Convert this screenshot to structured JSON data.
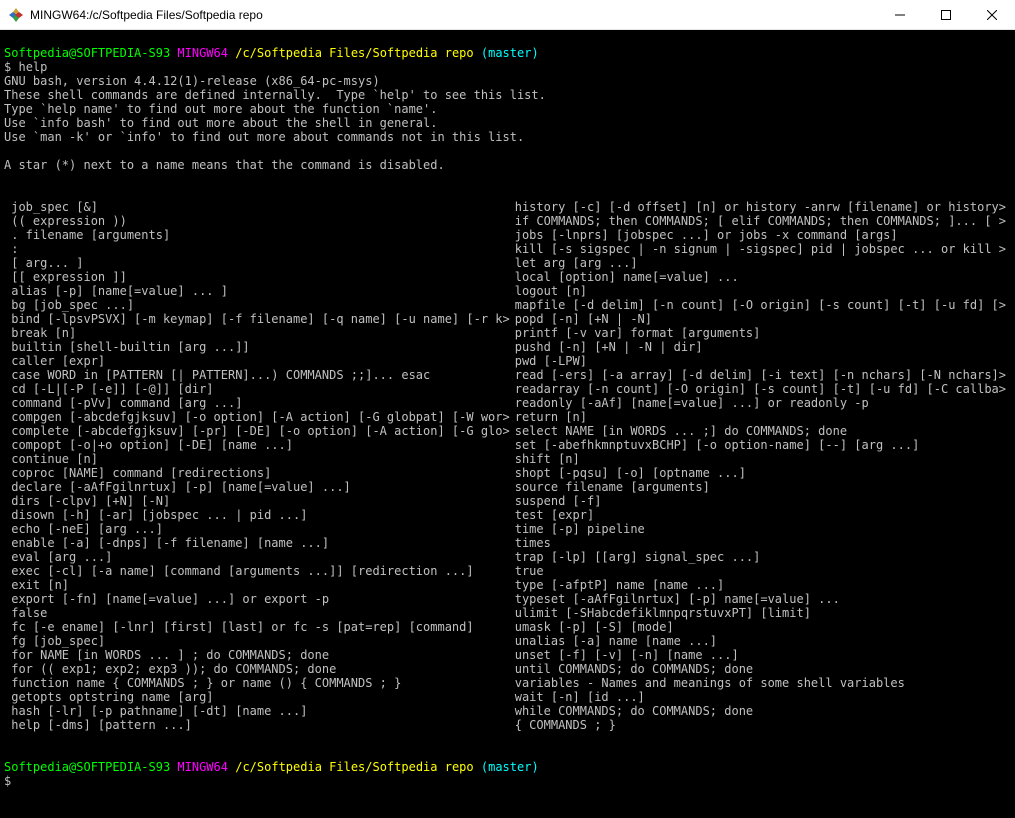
{
  "window": {
    "title": "MINGW64:/c/Softpedia Files/Softpedia repo"
  },
  "prompt": {
    "user_host": "Softpedia@SOFTPEDIA-S93",
    "env": "MINGW64",
    "path": "/c/Softpedia Files/Softpedia repo",
    "branch": "(master)",
    "dollar": "$"
  },
  "first_cmd": "help",
  "intro": [
    "GNU bash, version 4.4.12(1)-release (x86_64-pc-msys)",
    "These shell commands are defined internally.  Type `help' to see this list.",
    "Type `help name' to find out more about the function `name'.",
    "Use `info bash' to find out more about the shell in general.",
    "Use `man -k' or `info' to find out more about commands not in this list.",
    "",
    "A star (*) next to a name means that the command is disabled.",
    ""
  ],
  "help_left": [
    " job_spec [&]",
    " (( expression ))",
    " . filename [arguments]",
    " :",
    " [ arg... ]",
    " [[ expression ]]",
    " alias [-p] [name[=value] ... ]",
    " bg [job_spec ...]",
    " bind [-lpsvPSVX] [-m keymap] [-f filename] [-q name] [-u name] [-r k>",
    " break [n]",
    " builtin [shell-builtin [arg ...]]",
    " caller [expr]",
    " case WORD in [PATTERN [| PATTERN]...) COMMANDS ;;]... esac",
    " cd [-L|[-P [-e]] [-@]] [dir]",
    " command [-pVv] command [arg ...]",
    " compgen [-abcdefgjksuv] [-o option] [-A action] [-G globpat] [-W wor>",
    " complete [-abcdefgjksuv] [-pr] [-DE] [-o option] [-A action] [-G glo>",
    " compopt [-o|+o option] [-DE] [name ...]",
    " continue [n]",
    " coproc [NAME] command [redirections]",
    " declare [-aAfFgilnrtux] [-p] [name[=value] ...]",
    " dirs [-clpv] [+N] [-N]",
    " disown [-h] [-ar] [jobspec ... | pid ...]",
    " echo [-neE] [arg ...]",
    " enable [-a] [-dnps] [-f filename] [name ...]",
    " eval [arg ...]",
    " exec [-cl] [-a name] [command [arguments ...]] [redirection ...]",
    " exit [n]",
    " export [-fn] [name[=value] ...] or export -p",
    " false",
    " fc [-e ename] [-lnr] [first] [last] or fc -s [pat=rep] [command]",
    " fg [job_spec]",
    " for NAME [in WORDS ... ] ; do COMMANDS; done",
    " for (( exp1; exp2; exp3 )); do COMMANDS; done",
    " function name { COMMANDS ; } or name () { COMMANDS ; }",
    " getopts optstring name [arg]",
    " hash [-lr] [-p pathname] [-dt] [name ...]",
    " help [-dms] [pattern ...]"
  ],
  "help_right": [
    " history [-c] [-d offset] [n] or history -anrw [filename] or history>",
    " if COMMANDS; then COMMANDS; [ elif COMMANDS; then COMMANDS; ]... [ >",
    " jobs [-lnprs] [jobspec ...] or jobs -x command [args]",
    " kill [-s sigspec | -n signum | -sigspec] pid | jobspec ... or kill >",
    " let arg [arg ...]",
    " local [option] name[=value] ...",
    " logout [n]",
    " mapfile [-d delim] [-n count] [-O origin] [-s count] [-t] [-u fd] [>",
    " popd [-n] [+N | -N]",
    " printf [-v var] format [arguments]",
    " pushd [-n] [+N | -N | dir]",
    " pwd [-LPW]",
    " read [-ers] [-a array] [-d delim] [-i text] [-n nchars] [-N nchars]>",
    " readarray [-n count] [-O origin] [-s count] [-t] [-u fd] [-C callba>",
    " readonly [-aAf] [name[=value] ...] or readonly -p",
    " return [n]",
    " select NAME [in WORDS ... ;] do COMMANDS; done",
    " set [-abefhkmnptuvxBCHP] [-o option-name] [--] [arg ...]",
    " shift [n]",
    " shopt [-pqsu] [-o] [optname ...]",
    " source filename [arguments]",
    " suspend [-f]",
    " test [expr]",
    " time [-p] pipeline",
    " times",
    " trap [-lp] [[arg] signal_spec ...]",
    " true",
    " type [-afptP] name [name ...]",
    " typeset [-aAfFgilnrtux] [-p] name[=value] ...",
    " ulimit [-SHabcdefiklmnpqrstuvxPT] [limit]",
    " umask [-p] [-S] [mode]",
    " unalias [-a] name [name ...]",
    " unset [-f] [-v] [-n] [name ...]",
    " until COMMANDS; do COMMANDS; done",
    " variables - Names and meanings of some shell variables",
    " wait [-n] [id ...]",
    " while COMMANDS; do COMMANDS; done",
    " { COMMANDS ; }"
  ]
}
